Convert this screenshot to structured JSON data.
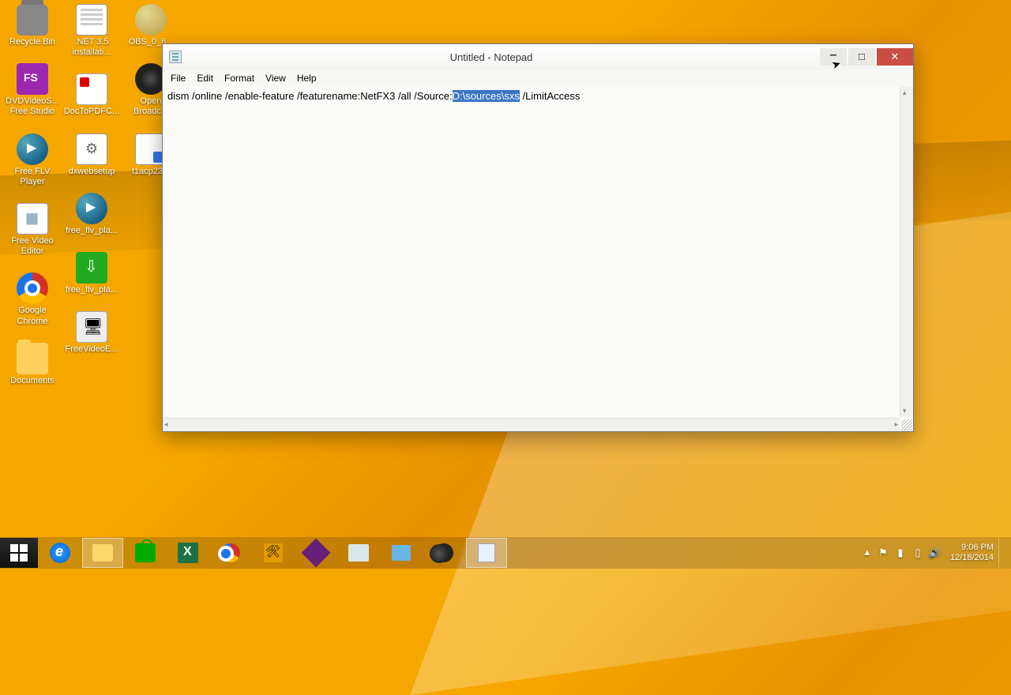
{
  "desktop": {
    "icons": [
      {
        "label": "Recycle Bin",
        "cls": "bin"
      },
      {
        "label": ".NET 3.5 installati...",
        "cls": "doc"
      },
      {
        "label": "OBS_0_6...",
        "cls": "globe"
      },
      {
        "label": "DVDVideoS... Free Studio",
        "cls": "fs"
      },
      {
        "label": "DocToPDFC...",
        "cls": "pdf"
      },
      {
        "label": "Open Broadc...",
        "cls": "obs"
      },
      {
        "label": "Free FLV Player",
        "cls": "play"
      },
      {
        "label": "dxwebsetup",
        "cls": "setup"
      },
      {
        "label": "t1acp23...",
        "cls": "exe"
      },
      {
        "label": "Free Video Editor",
        "cls": "vid"
      },
      {
        "label": "free_flv_pla...",
        "cls": "play"
      },
      {
        "label": "Google Chrome",
        "cls": "chrome"
      },
      {
        "label": "free_flv_pla...",
        "cls": "green"
      },
      {
        "label": "Documents",
        "cls": "folder"
      },
      {
        "label": "FreeVideoE...",
        "cls": "util"
      }
    ]
  },
  "notepad": {
    "title": "Untitled - Notepad",
    "menu": {
      "file": "File",
      "edit": "Edit",
      "format": "Format",
      "view": "View",
      "help": "Help"
    },
    "content": {
      "before_sel": "dism /online /enable-feature /featurename:NetFX3 /all /Source:",
      "selected": "D:\\sources\\sxs",
      "after_sel": " /LimitAccess"
    }
  },
  "taskbar": {
    "items": [
      {
        "name": "start",
        "cls": "start"
      },
      {
        "name": "ie",
        "cls": "ie"
      },
      {
        "name": "explorer",
        "cls": "fold-ic",
        "on": true
      },
      {
        "name": "store",
        "cls": "store"
      },
      {
        "name": "excel",
        "cls": "xl"
      },
      {
        "name": "chrome",
        "cls": "chrome chrome-t"
      },
      {
        "name": "tools",
        "cls": "tools"
      },
      {
        "name": "vs",
        "cls": "vs"
      },
      {
        "name": "sysinfo",
        "cls": "sys"
      },
      {
        "name": "remote",
        "cls": "remote"
      },
      {
        "name": "obs",
        "cls": "obs obs-t"
      },
      {
        "name": "notepad",
        "cls": "np-t",
        "on": true
      }
    ],
    "clock": {
      "time": "9:06 PM",
      "date": "12/18/2014"
    }
  }
}
